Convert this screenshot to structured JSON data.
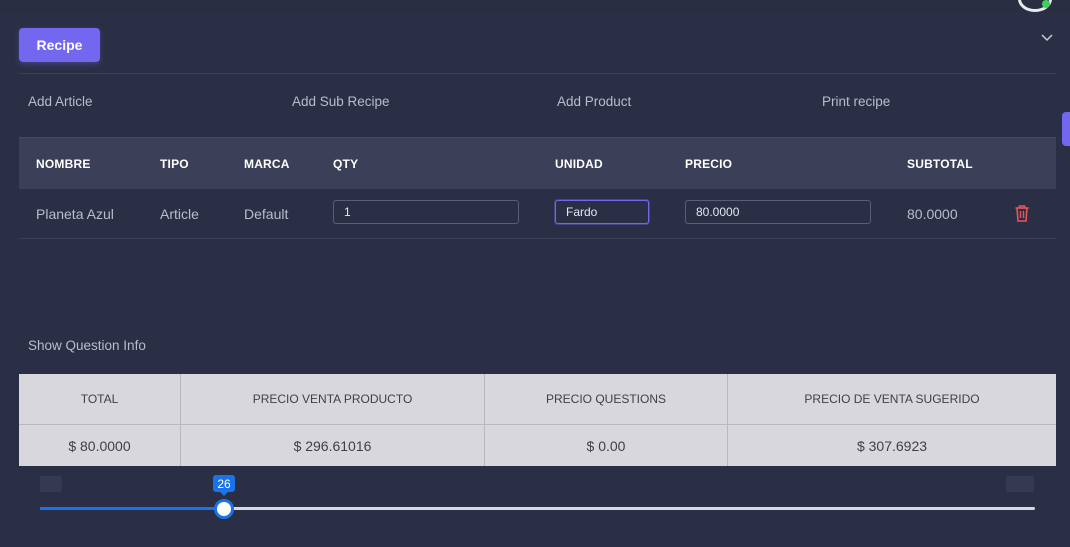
{
  "header": {
    "recipe_button": "Recipe",
    "collapse_icon": "chevron-down-icon"
  },
  "actions": {
    "add_article": "Add Article",
    "add_sub_recipe": "Add Sub Recipe",
    "add_product": "Add Product",
    "print_recipe": "Print recipe"
  },
  "table": {
    "columns": [
      "NOMBRE",
      "TIPO",
      "MARCA",
      "QTY",
      "UNIDAD",
      "PRECIO",
      "SUBTOTAL"
    ],
    "rows": [
      {
        "nombre": "Planeta Azul",
        "tipo": "Article",
        "marca": "Default",
        "qty": "1",
        "unidad": "Fardo",
        "precio": "80.0000",
        "subtotal": "80.0000",
        "delete_icon": "trash-icon"
      }
    ]
  },
  "question_info": {
    "label": "Show Question Info"
  },
  "summary": {
    "headers": [
      "TOTAL",
      "PRECIO VENTA PRODUCTO",
      "PRECIO QUESTIONS",
      "PRECIO DE VENTA SUGERIDO"
    ],
    "values": [
      "$ 80.0000",
      "$ 296.61016",
      "$ 0.00",
      "$ 307.6923"
    ]
  },
  "slider": {
    "value": 26,
    "value_label": "26",
    "fraction": 0.185
  },
  "colors": {
    "accent": "#7367f0",
    "slider": "#1a73e8",
    "danger": "#ea5455",
    "background": "#2b2f45"
  }
}
